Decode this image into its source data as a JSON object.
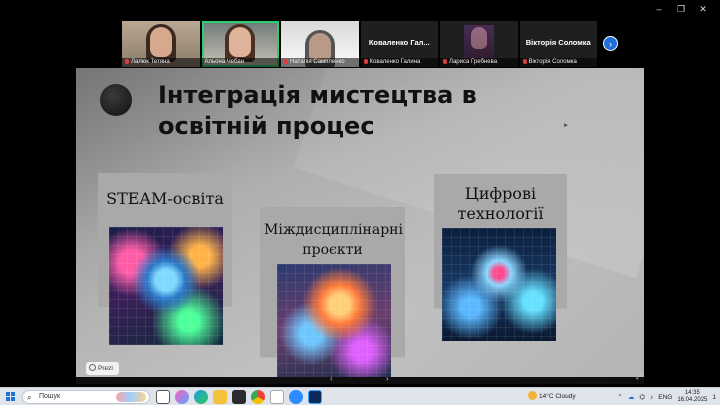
{
  "window_controls": {
    "minimize": "–",
    "restore": "❐",
    "close": "✕"
  },
  "participants": [
    {
      "name": "Лалюк Тетяна",
      "type": "video",
      "muted": true,
      "speaking": false
    },
    {
      "name": "Альона Чебан",
      "type": "video",
      "muted": false,
      "speaking": true
    },
    {
      "name": "Наталія Сампленко",
      "type": "video",
      "muted": true,
      "speaking": false
    },
    {
      "name": "Коваленко Галина",
      "display_name": "Коваленко Гал...",
      "type": "name",
      "muted": true,
      "speaking": false
    },
    {
      "name": "Лариса Гребнева",
      "type": "video",
      "muted": true,
      "speaking": false
    },
    {
      "name": "Вікторія Соломка",
      "display_name": "Вікторія Соломка",
      "type": "name",
      "muted": true,
      "speaking": false
    }
  ],
  "next_button_icon": "›",
  "slide": {
    "title": "Інтеграція мистецтва в освітній процес",
    "cards": [
      {
        "label": "STEAM-освіта",
        "image": "steam-education-illustration"
      },
      {
        "label": "Міждисциплінарні проєкти",
        "image": "interdisciplinary-projects-illustration"
      },
      {
        "label": "Цифрові технології",
        "image": "digital-technologies-illustration"
      }
    ],
    "watermark": "Prezi"
  },
  "bottom_bar": {
    "left_arrow": "‹",
    "right_arrow": "›",
    "fullscreen_icon": "⤢"
  },
  "taskbar": {
    "search_placeholder": "Пошук",
    "weather": "14°C  Cloudy",
    "language": "ENG",
    "time": "14:35",
    "date": "16.04.2025",
    "notification_count": "1"
  }
}
